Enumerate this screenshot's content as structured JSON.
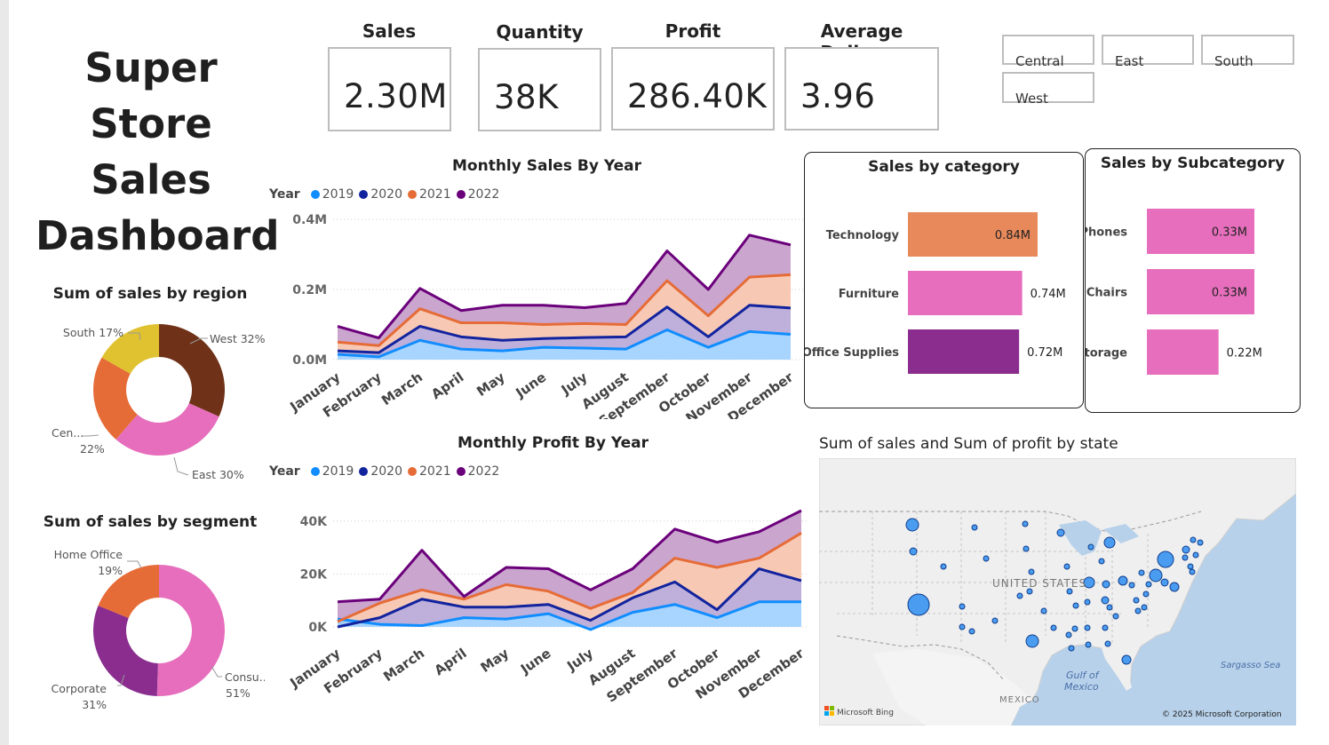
{
  "dashboard": {
    "title_lines": [
      "Super",
      "Store Sales",
      "Dashboard"
    ]
  },
  "kpis": [
    {
      "label": "Sales",
      "value": "2.30M"
    },
    {
      "label": "Quantity",
      "value": "38K"
    },
    {
      "label": "Profit",
      "value": "286.40K"
    },
    {
      "label": "Average Delivery",
      "value": "3.96"
    }
  ],
  "region_slicer": [
    "Central",
    "East",
    "South",
    "West"
  ],
  "colors": {
    "y2019": "#118dff",
    "y2020": "#12239e",
    "y2021": "#e66c37",
    "y2022": "#6b007b",
    "pink": "#e66ebc",
    "orange": "#e8895b",
    "purple": "#8a2d8f"
  },
  "legend": {
    "title": "Year",
    "years": [
      "2019",
      "2020",
      "2021",
      "2022"
    ]
  },
  "sales_chart": {
    "title": "Monthly Sales By Year",
    "chart_data": {
      "type": "area",
      "categories": [
        "January",
        "February",
        "March",
        "April",
        "May",
        "June",
        "July",
        "August",
        "September",
        "October",
        "November",
        "December"
      ],
      "y_ticks": [
        "0.4M",
        "0.2M",
        "0.0M"
      ],
      "ylim": [
        0,
        0.4
      ],
      "stacked": true,
      "series": [
        {
          "name": "2019",
          "values": [
            0.015,
            0.008,
            0.055,
            0.03,
            0.025,
            0.035,
            0.033,
            0.03,
            0.085,
            0.035,
            0.08,
            0.072
          ]
        },
        {
          "name": "2020",
          "values": [
            0.01,
            0.012,
            0.04,
            0.035,
            0.03,
            0.025,
            0.03,
            0.035,
            0.065,
            0.03,
            0.075,
            0.075
          ]
        },
        {
          "name": "2021",
          "values": [
            0.025,
            0.02,
            0.05,
            0.04,
            0.05,
            0.04,
            0.04,
            0.035,
            0.075,
            0.06,
            0.08,
            0.095
          ]
        },
        {
          "name": "2022",
          "values": [
            0.045,
            0.022,
            0.058,
            0.035,
            0.05,
            0.055,
            0.045,
            0.06,
            0.085,
            0.075,
            0.12,
            0.085
          ]
        }
      ]
    }
  },
  "profit_chart": {
    "title": "Monthly Profit By Year",
    "chart_data": {
      "type": "area",
      "categories": [
        "January",
        "February",
        "March",
        "April",
        "May",
        "June",
        "July",
        "August",
        "September",
        "October",
        "November",
        "December"
      ],
      "y_ticks": [
        "40K",
        "20K",
        "0K"
      ],
      "ylim": [
        -2000,
        45000
      ],
      "stacked": true,
      "series": [
        {
          "name": "2019",
          "values": [
            3000,
            1000,
            500,
            3500,
            3000,
            5000,
            -1000,
            5500,
            8500,
            3500,
            9500,
            9500
          ]
        },
        {
          "name": "2020",
          "values": [
            -3000,
            2500,
            10000,
            4000,
            4500,
            3500,
            3500,
            5500,
            8500,
            3000,
            12500,
            8000
          ]
        },
        {
          "name": "2021",
          "values": [
            2000,
            5500,
            3500,
            3000,
            8500,
            5000,
            4500,
            2000,
            9000,
            16000,
            4000,
            18000
          ]
        },
        {
          "name": "2022",
          "values": [
            7500,
            1500,
            15000,
            1000,
            6500,
            8500,
            7000,
            9000,
            11000,
            9500,
            10000,
            8500
          ]
        }
      ]
    }
  },
  "region_donut": {
    "title": "Sum of sales by region",
    "chart_data": {
      "type": "pie",
      "slices": [
        {
          "name": "West",
          "value": 32,
          "label": "West 32%",
          "color": "#6f3218"
        },
        {
          "name": "East",
          "value": 30,
          "label": "East 30%",
          "color": "#e66ebc"
        },
        {
          "name": "Central",
          "value": 22,
          "label_top": "Cen...",
          "label_bottom": "22%",
          "color": "#e66c37"
        },
        {
          "name": "South",
          "value": 17,
          "label": "South 17%",
          "color": "#e0c12f"
        }
      ]
    }
  },
  "segment_donut": {
    "title": "Sum of sales by segment",
    "chart_data": {
      "type": "pie",
      "slices": [
        {
          "name": "Consumer",
          "value": 51,
          "label_top": "Consu...",
          "label_bottom": "51%",
          "color": "#e66ebc"
        },
        {
          "name": "Corporate",
          "value": 31,
          "label_top": "Corporate",
          "label_bottom": "31%",
          "color": "#8a2d8f"
        },
        {
          "name": "Home Office",
          "value": 19,
          "label_top": "Home Office",
          "label_bottom": "19%",
          "color": "#e66c37"
        }
      ]
    }
  },
  "category_chart": {
    "title": "Sales by category",
    "chart_data": {
      "type": "bar",
      "categories": [
        "Technology",
        "Furniture",
        "Office Supplies"
      ],
      "values": [
        0.84,
        0.74,
        0.72
      ],
      "labels": [
        "0.84M",
        "0.74M",
        "0.72M"
      ],
      "colors": [
        "#e8895b",
        "#e66ebc",
        "#8a2d8f"
      ]
    }
  },
  "subcategory_chart": {
    "title": "Sales by Subcategory",
    "chart_data": {
      "type": "bar",
      "categories": [
        "Phones",
        "Chairs",
        "Storage"
      ],
      "values": [
        0.33,
        0.33,
        0.22
      ],
      "labels": [
        "0.33M",
        "0.33M",
        "0.22M"
      ],
      "colors": [
        "#e66ebc",
        "#e66ebc",
        "#e66ebc"
      ]
    }
  },
  "map": {
    "title": "Sum of sales and Sum of profit by state",
    "labels": {
      "country": "UNITED STATES",
      "gulf_line1": "Gulf of",
      "gulf_line2": "Mexico",
      "mexico": "MEXICO",
      "sargasso": "Sargasso Sea"
    },
    "bing": "Microsoft Bing",
    "copyright": "© 2025 Microsoft Corporation"
  }
}
